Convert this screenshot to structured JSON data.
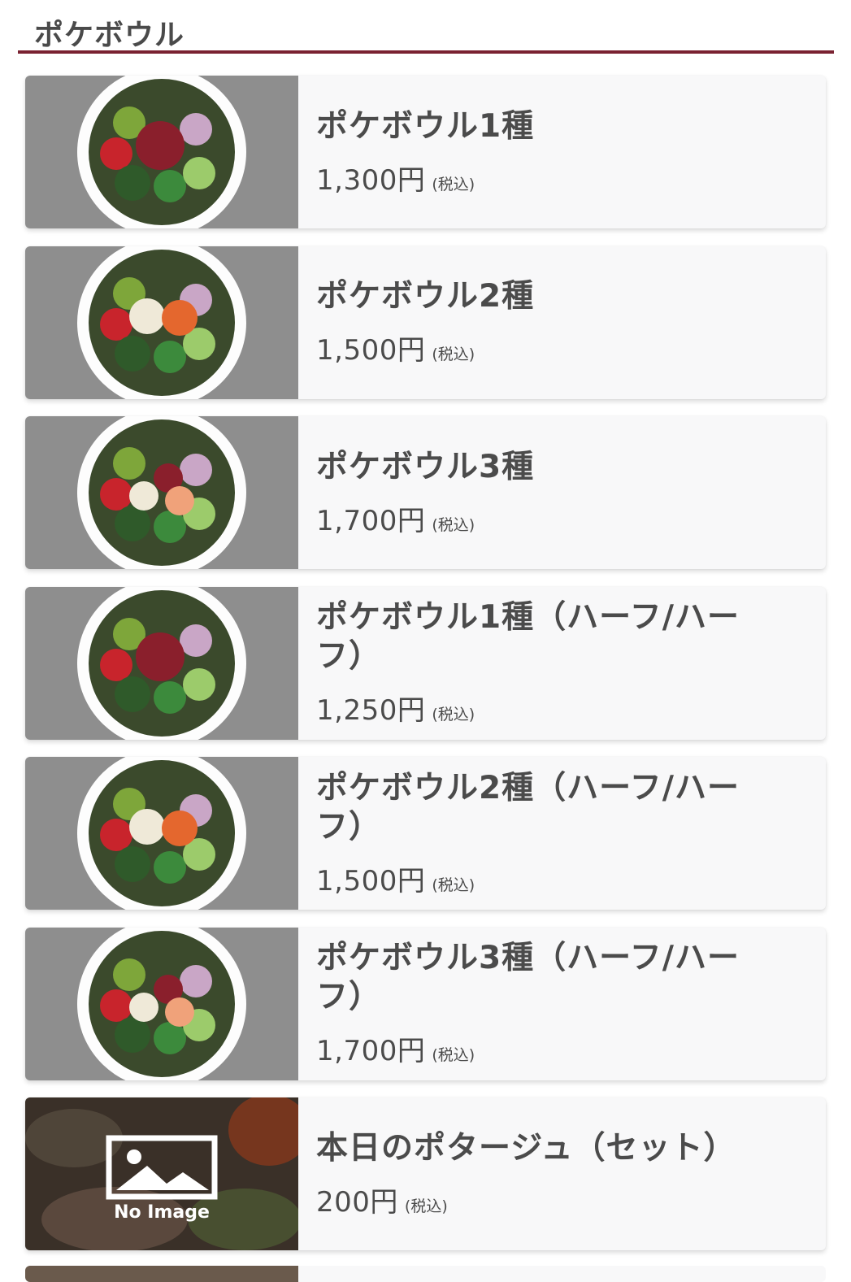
{
  "section": {
    "title": "ポケボウル"
  },
  "items": [
    {
      "name": "ポケボウル1種",
      "price": "1,300円",
      "tax_note": "(税込)",
      "image": "poke-bowl-tuna"
    },
    {
      "name": "ポケボウル2種",
      "price": "1,500円",
      "tax_note": "(税込)",
      "image": "poke-bowl-salmon-tofu"
    },
    {
      "name": "ポケボウル3種",
      "price": "1,700円",
      "tax_note": "(税込)",
      "image": "poke-bowl-mixed"
    },
    {
      "name": "ポケボウル1種（ハーフ/ハーフ）",
      "price": "1,250円",
      "tax_note": "(税込)",
      "image": "poke-bowl-tuna"
    },
    {
      "name": "ポケボウル2種（ハーフ/ハーフ）",
      "price": "1,500円",
      "tax_note": "(税込)",
      "image": "poke-bowl-salmon-tofu"
    },
    {
      "name": "ポケボウル3種（ハーフ/ハーフ）",
      "price": "1,700円",
      "tax_note": "(税込)",
      "image": "poke-bowl-mixed"
    },
    {
      "name": "本日のポタージュ（セット）",
      "price": "200円",
      "tax_note": "(税込)",
      "image": "no-image",
      "no_image_label": "No Image"
    }
  ],
  "colors": {
    "accent": "#7a2231",
    "text": "#4b4b4b",
    "card_bg": "#f8f8f9"
  }
}
